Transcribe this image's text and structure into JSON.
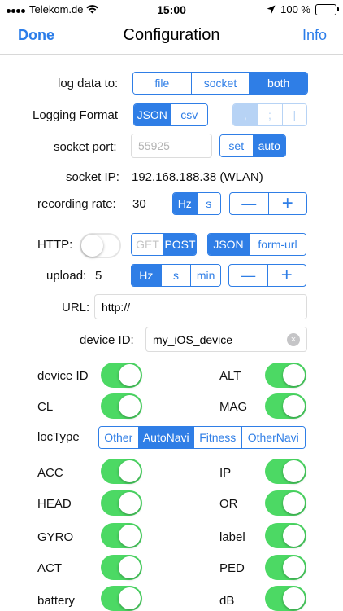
{
  "status": {
    "carrier": "Telekom.de",
    "time": "15:00",
    "battery": "100 %"
  },
  "nav": {
    "done": "Done",
    "title": "Configuration",
    "info": "Info"
  },
  "log": {
    "label": "log data to:",
    "options": [
      "file",
      "socket",
      "both"
    ],
    "selected": 2
  },
  "format": {
    "label": "Logging Format",
    "options": [
      "JSON",
      "csv"
    ],
    "separators": [
      ",",
      ";",
      "|"
    ]
  },
  "socket": {
    "port_label": "socket port:",
    "port_placeholder": "55925",
    "set": "set",
    "auto": "auto",
    "ip_label": "socket IP:",
    "ip_value": "192.168.188.38 (WLAN)"
  },
  "recording": {
    "label": "recording rate:",
    "value": "30",
    "units": [
      "Hz",
      "s"
    ],
    "minus": "—",
    "plus": "+"
  },
  "http": {
    "label": "HTTP:",
    "methods": [
      "GET",
      "POST"
    ],
    "formats": [
      "JSON",
      "form-url"
    ]
  },
  "upload": {
    "label": "upload:",
    "value": "5",
    "units": [
      "Hz",
      "s",
      "min"
    ],
    "minus": "—",
    "plus": "+"
  },
  "url": {
    "label": "URL:",
    "value": "http://"
  },
  "device": {
    "label": "device ID:",
    "value": "my_iOS_device",
    "clear": "×"
  },
  "loc": {
    "label": "locType",
    "options": [
      "Other",
      "AutoNavi",
      "Fitness",
      "OtherNavi"
    ],
    "selected": 1
  },
  "toggles_left": [
    "device ID",
    "CL",
    "ACC",
    "HEAD",
    "GYRO",
    "ACT",
    "battery"
  ],
  "toggles_right": [
    "ALT",
    "MAG",
    "IP",
    "OR",
    "label",
    "PED",
    "dB"
  ],
  "colors": {
    "accent": "#2f7ee6",
    "switch_on": "#4cd964"
  }
}
